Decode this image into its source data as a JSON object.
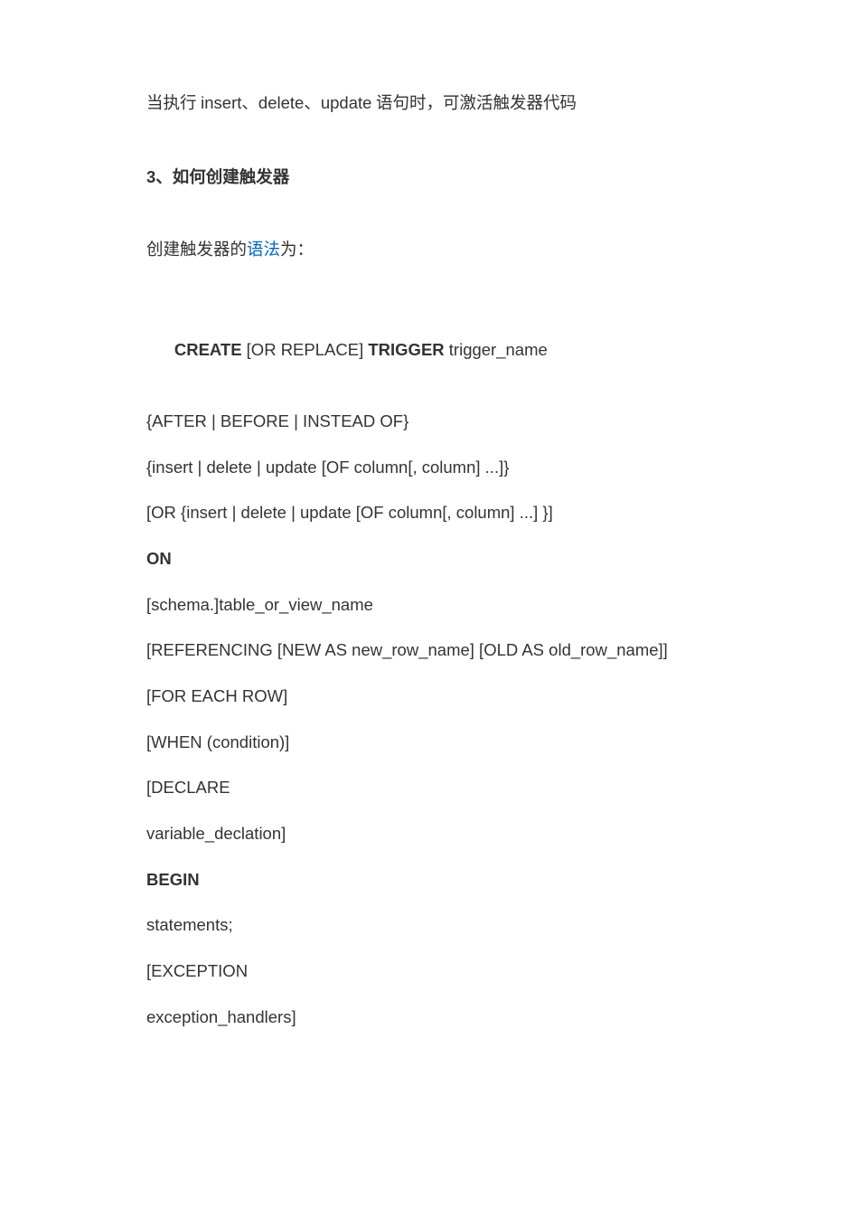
{
  "paragraphs": {
    "p1_pre": "当执行 ",
    "p1_ins": "insert",
    "p1_sep": "、",
    "p1_del": "delete",
    "p1_upd": "update",
    "p1_post": " 语句时，可激活触发器代码"
  },
  "heading": "3、如何创建触发器",
  "desc": {
    "pre": "创建触发器的",
    "link": "语法",
    "post": "为："
  },
  "code": {
    "l1a": "CREATE",
    "l1b": " [OR REPLACE] ",
    "l1c": "TRIGGER",
    "l1d": " trigger_name",
    "l2": "{AFTER | BEFORE | INSTEAD OF}",
    "l3": "{insert | delete | update [OF column[, column] ...]}",
    "l4": "[OR {insert | delete | update [OF column[, column] ...] }]",
    "l5": "ON",
    "l6": "[schema.]table_or_view_name",
    "l7": "[REFERENCING [NEW AS new_row_name] [OLD AS old_row_name]]",
    "l8": "[FOR EACH ROW]",
    "l9": "[WHEN (condition)]",
    "l10": "[DECLARE",
    "l11": "variable_declation]",
    "l12": "BEGIN",
    "l13": "statements;",
    "l14": "[EXCEPTION",
    "l15": "exception_handlers]"
  }
}
